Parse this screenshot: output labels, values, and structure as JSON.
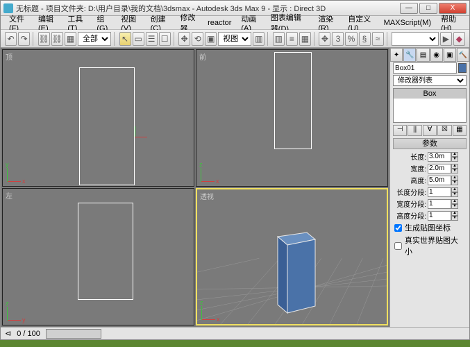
{
  "title": "无标题    - 项目文件夹: D:\\用户目录\\我的文档\\3dsmax    - Autodesk 3ds Max 9       - 显示 : Direct 3D",
  "winbtns": {
    "min": "—",
    "max": "□",
    "close": "X"
  },
  "menu": [
    "文件(F)",
    "编辑(E)",
    "工具(T)",
    "组(G)",
    "视图(V)",
    "创建(C)",
    "修改器",
    "reactor",
    "动画(A)",
    "图表编辑器(D)",
    "渲染(R)",
    "自定义(U)",
    "MAXScript(M)",
    "帮助(H)"
  ],
  "toolbar": {
    "undo": "↶",
    "redo": "↷",
    "link": "⛓",
    "unlink": "⛓",
    "sel": "▦",
    "drop1": "全部",
    "cursor": "↖",
    "selrect": "▭",
    "selname": "☰",
    "selwin": "☐",
    "move": "✥",
    "rot": "⟲",
    "scale": "▣",
    "ref": "视图",
    "mirror": "▥",
    "align": "≡",
    "array": "▦",
    "snap": "✥",
    "ang": "3",
    "pct": "%",
    "edge": "§",
    "measure": "≈"
  },
  "viewports": {
    "top": "顶",
    "front": "前",
    "left": "左",
    "persp": "透视"
  },
  "object": {
    "name": "Box01"
  },
  "modifier": {
    "drop": "修改器列表",
    "item": "Box"
  },
  "params_header": "参数",
  "params": {
    "length_l": "长度:",
    "length_v": "3.0m",
    "width_l": "宽度:",
    "width_v": "2.0m",
    "height_l": "高度:",
    "height_v": "5.0m",
    "lseg_l": "长度分段:",
    "lseg_v": "1",
    "wseg_l": "宽度分段:",
    "wseg_v": "1",
    "hseg_l": "高度分段:",
    "hseg_v": "1",
    "mapcoords": "生成贴图坐标",
    "realworld": "真实世界贴图大小"
  },
  "status": {
    "frame": "0 / 100"
  }
}
